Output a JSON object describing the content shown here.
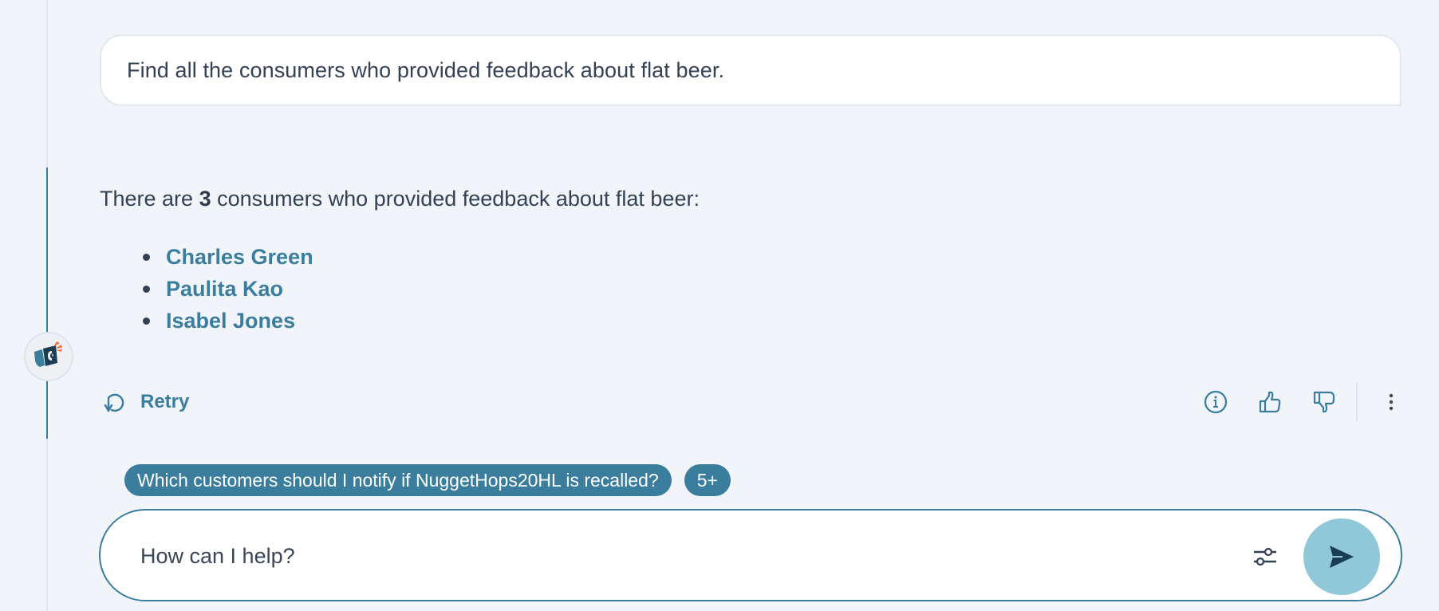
{
  "conversation": {
    "user_message": "Find all the consumers who provided feedback about flat beer.",
    "assistant": {
      "answer_prefix": "There are ",
      "answer_count": "3",
      "answer_suffix": " consumers who provided feedback about flat beer:",
      "consumers": [
        {
          "name": "Charles Green"
        },
        {
          "name": "Paulita Kao"
        },
        {
          "name": "Isabel Jones"
        }
      ],
      "avatar_icon": "brand-logo-icon"
    },
    "actions": {
      "retry_label": "Retry",
      "retry_icon": "retry-icon",
      "info_icon": "info-icon",
      "thumbs_up_icon": "thumbs-up-icon",
      "thumbs_down_icon": "thumbs-down-icon",
      "more_icon": "kebab-menu-icon"
    }
  },
  "suggestions": {
    "items": [
      {
        "label": "Which customers should I notify if NuggetHops20HL is recalled?"
      }
    ],
    "more_label": "5+"
  },
  "composer": {
    "placeholder": "How can I help?",
    "value": "",
    "settings_icon": "sliders-icon",
    "send_icon": "send-icon"
  },
  "colors": {
    "accent": "#3a7d9c",
    "send_button": "#90c8da",
    "send_arrow": "#1a3d52",
    "background": "#f1f4f9",
    "text": "#334155",
    "logo_orange": "#e8734a"
  }
}
